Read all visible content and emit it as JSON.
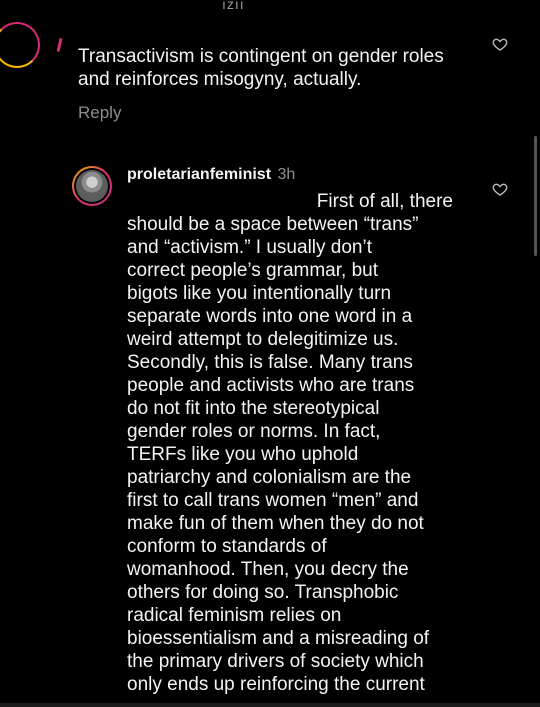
{
  "top_fragment": "ızıı",
  "comment_1": {
    "text": "Transactivism is contingent on gender roles and reinforces misogyny, actually.",
    "reply_label": "Reply"
  },
  "comment_2": {
    "username": "proletarianfeminist",
    "timestamp": "3h",
    "lines": [
      "First of all, there",
      "should be a space between “trans”",
      "and “activism.” I usually don’t",
      "correct people’s grammar, but",
      "bigots like you intentionally turn",
      "separate words into one word in a",
      "weird attempt to delegitimize us.",
      "Secondly, this is false. Many trans",
      "people and activists who are trans",
      "do not fit into the stereotypical",
      "gender roles or norms. In fact,",
      "TERFs like you who uphold",
      "patriarchy and colonialism are the",
      "first to call trans women “men” and",
      "make fun of them when they do not",
      "conform to standards of",
      "womanhood. Then, you decry the",
      "others for doing so. Transphobic",
      "radical feminism relies on",
      "bioessentialism and a misreading of",
      "the primary drivers of society which",
      "only ends up reinforcing the current"
    ]
  },
  "icons": {
    "like": "heart-outline-icon",
    "avatar": "profile-photo"
  },
  "colors": {
    "background": "#000000",
    "text": "#f3f3f3",
    "muted": "#8e8e8e",
    "story_ring_start": "#f5b800",
    "story_ring_end": "#c13584"
  }
}
